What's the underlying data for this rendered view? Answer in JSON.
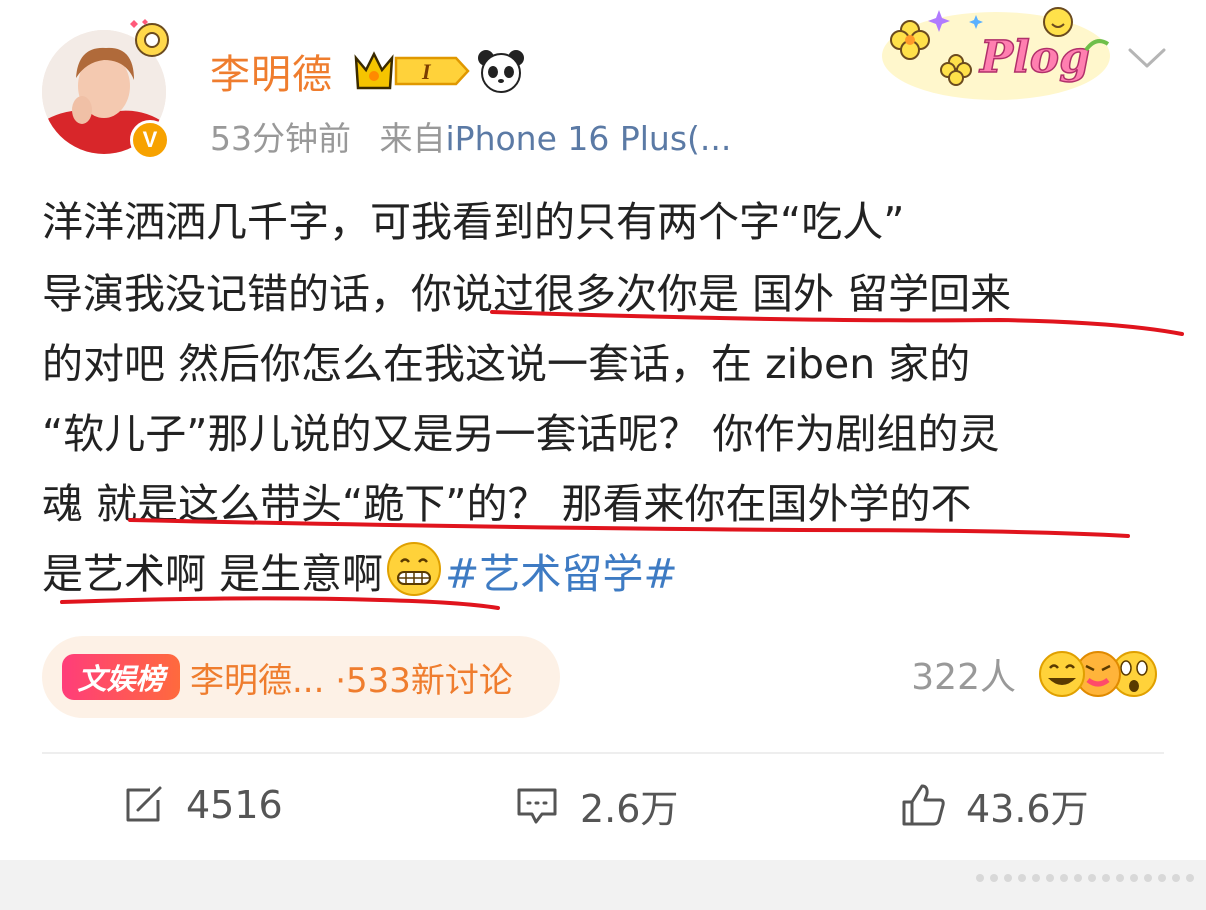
{
  "post": {
    "author": {
      "name": "李明德",
      "member_level": "I"
    },
    "meta": {
      "time": "53分钟前",
      "source_label": "来自",
      "source_device": "iPhone 16 Plus(..."
    },
    "sticker_text": "Plog",
    "content_lines": [
      "洋洋洒洒几千字，可我看到的只有两个字“吃人”",
      "导演我没记错的话，你说过很多次你是 国外 留学回来",
      "的对吧 然后你怎么在我这说一套话，在 ziben 家的",
      "“软儿子”那儿说的又是另一套话呢？ 你作为剧组的灵",
      "魂 就是这么带头“跪下”的？ 那看来你在国外学的不",
      "是艺术啊 是生意啊"
    ],
    "hashtag": "#艺术留学#",
    "topic": {
      "badge": "文娱榜",
      "text": "李明德... ·533新讨论"
    },
    "reactions": {
      "count": "322人"
    },
    "actions": {
      "repost": "4516",
      "comment": "2.6万",
      "like": "43.6万"
    }
  },
  "icons": {
    "avatar": "avatar-photo",
    "verified": "verified-v-icon",
    "member": "crown-member-icon",
    "panda": "panda-icon",
    "sticker": "plog-sticker-icon",
    "more": "chevron-down-icon",
    "grin": "grin-emoji-icon",
    "repost": "repost-icon",
    "comment": "comment-icon",
    "like": "thumbs-up-icon"
  },
  "colors": {
    "username": "#ef7d2e",
    "hashtag": "#3e7bc3",
    "underline": "#e0141d",
    "topic_bg": "#fdf1e6"
  }
}
